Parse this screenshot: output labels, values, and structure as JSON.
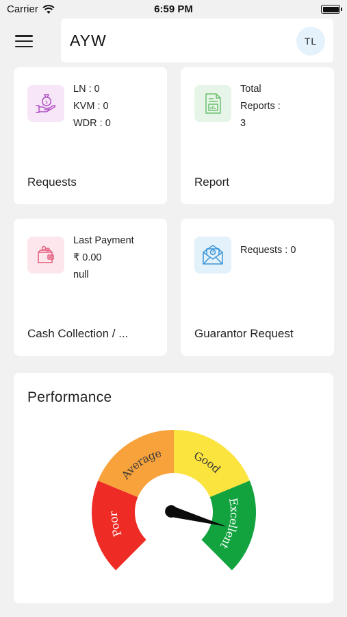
{
  "status_bar": {
    "carrier": "Carrier",
    "time": "6:59 PM"
  },
  "header": {
    "title": "AYW",
    "avatar_initials": "TL"
  },
  "tiles": {
    "requests": {
      "label": "Requests",
      "lines": [
        "LN : 0",
        "KVM : 0",
        "WDR : 0"
      ],
      "icon": "money-bag-hand-icon",
      "icon_bg": "#f6e6f8",
      "icon_color": "#b04dc6"
    },
    "report": {
      "label": "Report",
      "lines": [
        "Total",
        "Reports :",
        "3"
      ],
      "icon": "report-document-icon",
      "icon_bg": "#e6f5e7",
      "icon_color": "#6cc070"
    },
    "cash": {
      "label": "Cash Collection / ...",
      "lines": [
        "Last Payment",
        "₹ 0.00",
        "null"
      ],
      "icon": "wallet-icon",
      "icon_bg": "#fde7ec",
      "icon_color": "#e35a7c"
    },
    "guarantor": {
      "label": "Guarantor Request",
      "lines": [
        "Requests : 0"
      ],
      "icon": "envelope-question-icon",
      "icon_bg": "#e3f1fb",
      "icon_color": "#3a95d8"
    }
  },
  "performance": {
    "title": "Performance",
    "gauge": {
      "segments": [
        {
          "label": "Poor",
          "color": "#ef2b25"
        },
        {
          "label": "Average",
          "color": "#f7a23b"
        },
        {
          "label": "Good",
          "color": "#fbe43d"
        },
        {
          "label": "Excellent",
          "color": "#12a33f"
        }
      ],
      "needle_value": 0.89
    }
  }
}
